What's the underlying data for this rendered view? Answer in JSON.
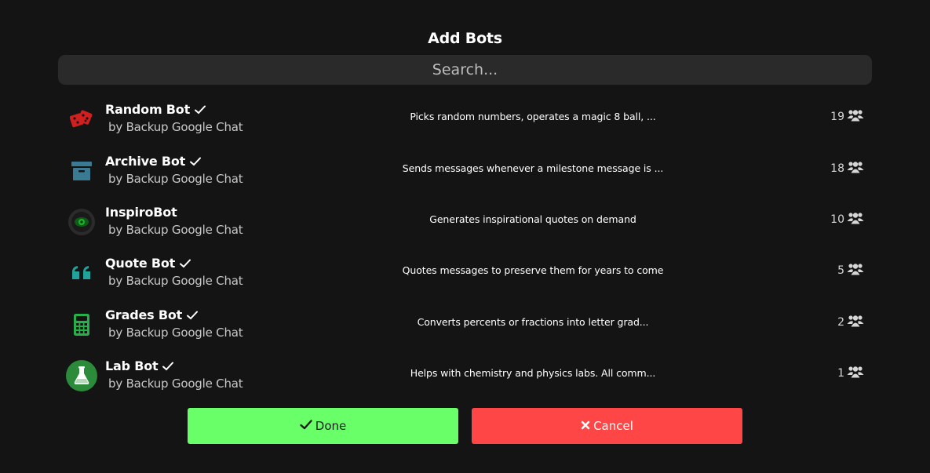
{
  "dialog": {
    "title": "Add Bots",
    "search": {
      "placeholder": "Search...",
      "value": ""
    }
  },
  "bots": [
    {
      "name": "Random Bot",
      "verified": true,
      "author": "by Backup Google Chat",
      "description": "Picks random numbers, operates a magic 8 ball, ...",
      "count": "19",
      "icon": "dice-icon",
      "icon_color": "#d11f1f"
    },
    {
      "name": "Archive Bot",
      "verified": true,
      "author": "by Backup Google Chat",
      "description": "Sends messages whenever a milestone message is ...",
      "count": "18",
      "icon": "archive-box-icon",
      "icon_color": "#3b7a93"
    },
    {
      "name": "InspiroBot",
      "verified": false,
      "author": "by Backup Google Chat",
      "description": "Generates inspirational quotes on demand",
      "count": "10",
      "icon": "inspirobot-eye-icon",
      "icon_color": "#1f9b2a"
    },
    {
      "name": "Quote Bot",
      "verified": true,
      "author": "by Backup Google Chat",
      "description": "Quotes messages to preserve them for years to come",
      "count": "5",
      "icon": "quote-marks-icon",
      "icon_color": "#1fa39a"
    },
    {
      "name": "Grades Bot",
      "verified": true,
      "author": "by Backup Google Chat",
      "description": "Converts percents or fractions into letter grad...",
      "count": "2",
      "icon": "calculator-icon",
      "icon_color": "#27b04a"
    },
    {
      "name": "Lab Bot",
      "verified": true,
      "author": "by Backup Google Chat",
      "description": "Helps with chemistry and physics labs. All comm...",
      "count": "1",
      "icon": "flask-icon",
      "icon_color": "#2c8b3a"
    }
  ],
  "buttons": {
    "done_label": "Done",
    "cancel_label": "Cancel",
    "done_color": "#69ff69",
    "cancel_color": "#ff4646"
  }
}
